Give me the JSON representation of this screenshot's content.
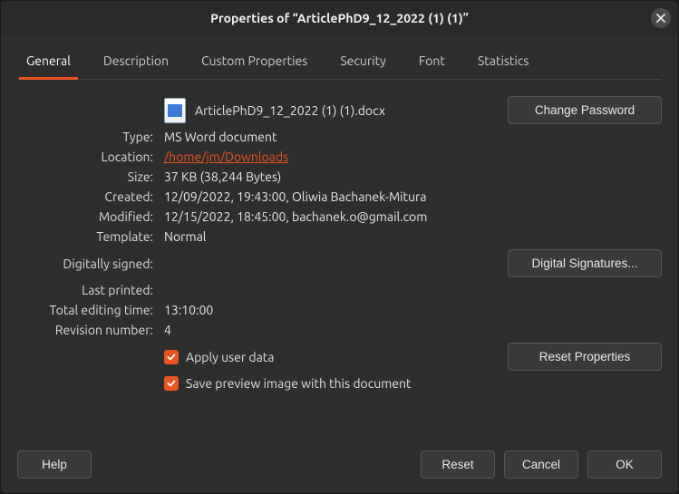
{
  "title": "Properties of “ArticlePhD9_12_2022 (1) (1)”",
  "tabs": {
    "general": "General",
    "description": "Description",
    "custom": "Custom Properties",
    "security": "Security",
    "font": "Font",
    "stats": "Statistics",
    "active": "general"
  },
  "file": {
    "name": "ArticlePhD9_12_2022 (1) (1).docx"
  },
  "buttons": {
    "change_password": "Change Password",
    "digital_signatures": "Digital Signatures...",
    "reset_properties": "Reset Properties",
    "help": "Help",
    "reset": "Reset",
    "cancel": "Cancel",
    "ok": "OK"
  },
  "labels": {
    "type": "Type:",
    "location": "Location:",
    "size": "Size:",
    "created": "Created:",
    "modified": "Modified:",
    "template": "Template:",
    "digitally_signed": "Digitally signed:",
    "last_printed": "Last printed:",
    "total_editing_time": "Total editing time:",
    "revision_number": "Revision number:"
  },
  "values": {
    "type": "MS Word document",
    "location": "/home/jm/Downloads",
    "size": "37 KB (38,244 Bytes)",
    "created": "12/09/2022, 19:43:00, Oliwia Bachanek-Mitura",
    "modified": "12/15/2022, 18:45:00, bachanek.o@gmail.com",
    "template": "Normal",
    "digitally_signed": "",
    "last_printed": "",
    "total_editing_time": "13:10:00",
    "revision_number": "4"
  },
  "checkboxes": {
    "apply_user_data": {
      "label": "Apply user data",
      "checked": true
    },
    "save_preview": {
      "label": "Save preview image with this document",
      "checked": true
    }
  }
}
